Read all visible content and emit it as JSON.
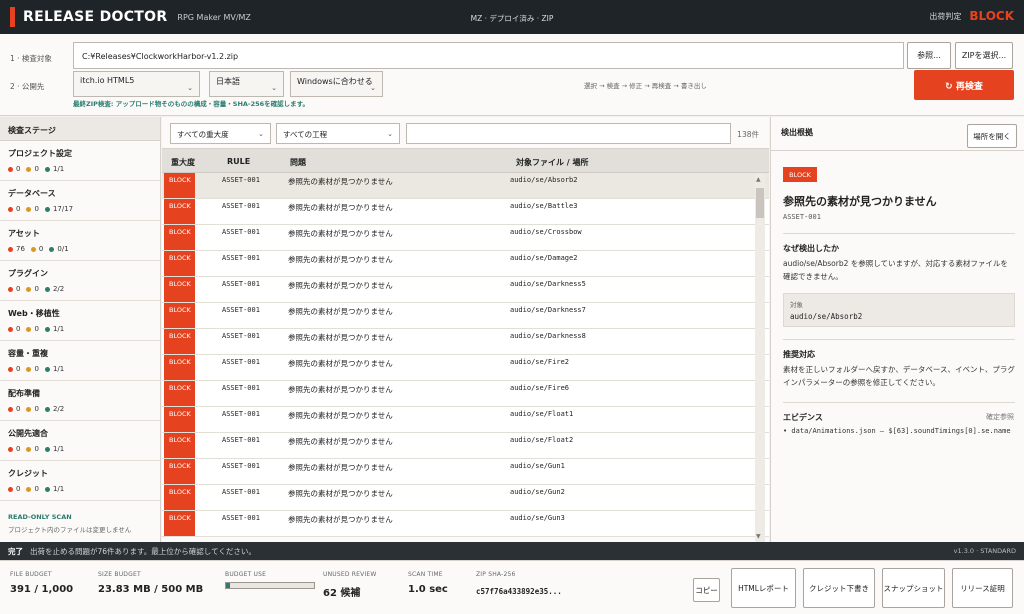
{
  "app": {
    "title": "RELEASE DOCTOR",
    "subtitle": "RPG Maker MV/MZ",
    "center_status": "MZ · デプロイ済み · ZIP",
    "verdict_label": "出荷判定",
    "verdict_value": "BLOCK"
  },
  "inputs": {
    "target_label": "1 · 検査対象",
    "target_path": "C:¥Releases¥ClockworkHarbor-v1.2.zip",
    "browse_label": "参照...",
    "zip_select_label": "ZIPを選択...",
    "publish_label": "2 · 公開先",
    "platform": "itch.io HTML5",
    "language": "日本語",
    "environment": "Windowsに合わせる",
    "flow": "選択 → 検査 → 修正 → 再検査 → 書き出し",
    "rescan_label": "↻ 再検査",
    "zip_note": "最終ZIP検査: アップロード物そのものの構成・容量・SHA-256を確認します。"
  },
  "stages": {
    "header": "検査ステージ",
    "items": [
      {
        "name": "プロジェクト設定",
        "red": "0",
        "amber": "0",
        "teal": "1/1"
      },
      {
        "name": "データベース",
        "red": "0",
        "amber": "0",
        "teal": "17/17"
      },
      {
        "name": "アセット",
        "red": "76",
        "amber": "0",
        "teal": "0/1"
      },
      {
        "name": "プラグイン",
        "red": "0",
        "amber": "0",
        "teal": "2/2"
      },
      {
        "name": "Web・移植性",
        "red": "0",
        "amber": "0",
        "teal": "1/1"
      },
      {
        "name": "容量・重複",
        "red": "0",
        "amber": "0",
        "teal": "1/1"
      },
      {
        "name": "配布準備",
        "red": "0",
        "amber": "0",
        "teal": "2/2"
      },
      {
        "name": "公開先適合",
        "red": "0",
        "amber": "0",
        "teal": "1/1"
      },
      {
        "name": "クレジット",
        "red": "0",
        "amber": "0",
        "teal": "1/1"
      }
    ],
    "readonly_title": "READ-ONLY SCAN",
    "readonly_desc": "プロジェクト内のファイルは変更しません"
  },
  "filters": {
    "severity": "すべての重大度",
    "process": "すべての工程",
    "search_value": "",
    "count": "138件"
  },
  "table": {
    "headers": {
      "severity": "重大度",
      "rule": "RULE",
      "issue": "問題",
      "file": "対象ファイル / 場所"
    },
    "rows": [
      {
        "severity": "BLOCK",
        "rule": "ASSET-001",
        "issue": "参照先の素材が見つかりません",
        "file": "audio/se/Absorb2"
      },
      {
        "severity": "BLOCK",
        "rule": "ASSET-001",
        "issue": "参照先の素材が見つかりません",
        "file": "audio/se/Battle3"
      },
      {
        "severity": "BLOCK",
        "rule": "ASSET-001",
        "issue": "参照先の素材が見つかりません",
        "file": "audio/se/Crossbow"
      },
      {
        "severity": "BLOCK",
        "rule": "ASSET-001",
        "issue": "参照先の素材が見つかりません",
        "file": "audio/se/Damage2"
      },
      {
        "severity": "BLOCK",
        "rule": "ASSET-001",
        "issue": "参照先の素材が見つかりません",
        "file": "audio/se/Darkness5"
      },
      {
        "severity": "BLOCK",
        "rule": "ASSET-001",
        "issue": "参照先の素材が見つかりません",
        "file": "audio/se/Darkness7"
      },
      {
        "severity": "BLOCK",
        "rule": "ASSET-001",
        "issue": "参照先の素材が見つかりません",
        "file": "audio/se/Darkness8"
      },
      {
        "severity": "BLOCK",
        "rule": "ASSET-001",
        "issue": "参照先の素材が見つかりません",
        "file": "audio/se/Fire2"
      },
      {
        "severity": "BLOCK",
        "rule": "ASSET-001",
        "issue": "参照先の素材が見つかりません",
        "file": "audio/se/Fire6"
      },
      {
        "severity": "BLOCK",
        "rule": "ASSET-001",
        "issue": "参照先の素材が見つかりません",
        "file": "audio/se/Float1"
      },
      {
        "severity": "BLOCK",
        "rule": "ASSET-001",
        "issue": "参照先の素材が見つかりません",
        "file": "audio/se/Float2"
      },
      {
        "severity": "BLOCK",
        "rule": "ASSET-001",
        "issue": "参照先の素材が見つかりません",
        "file": "audio/se/Gun1"
      },
      {
        "severity": "BLOCK",
        "rule": "ASSET-001",
        "issue": "参照先の素材が見つかりません",
        "file": "audio/se/Gun2"
      },
      {
        "severity": "BLOCK",
        "rule": "ASSET-001",
        "issue": "参照先の素材が見つかりません",
        "file": "audio/se/Gun3"
      }
    ]
  },
  "detail": {
    "header": "検出根拠",
    "locate_label": "場所を開く",
    "badge": "BLOCK",
    "title": "参照先の素材が見つかりません",
    "rule": "ASSET-001",
    "why_title": "なぜ検出したか",
    "why_text": "audio/se/Absorb2 を参照していますが、対応する素材ファイルを確認できません。",
    "target_label": "対象",
    "target_value": "audio/se/Absorb2",
    "fix_title": "推奨対応",
    "fix_text": "素材を正しいフォルダーへ戻すか、データベース、イベント、プラグインパラメーターの参照を修正してください。",
    "evidence_title": "エビデンス",
    "evidence_link": "確定参照",
    "evidence_item": "• data/Animations.json — $[63].soundTimings[0].se.name"
  },
  "status": {
    "label": "完了",
    "message": "出荷を止める問題が76件あります。最上位から確認してください。",
    "version": "v1.3.0 · STANDARD"
  },
  "footer": {
    "file_budget_label": "FILE BUDGET",
    "file_budget_value": "391 / 1,000",
    "size_budget_label": "SIZE BUDGET",
    "size_budget_value": "23.83 MB / 500 MB",
    "budget_use_label": "BUDGET USE",
    "budget_use_fraction": 0.05,
    "unused_label": "UNUSED REVIEW",
    "unused_value": "62 候補",
    "scan_time_label": "SCAN TIME",
    "scan_time_value": "1.0 sec",
    "sha_label": "ZIP SHA-256",
    "sha_value": "c57f76a433892e35...",
    "copy_label": "コピー",
    "html_report_label": "HTMLレポート",
    "credit_draft_label": "クレジット下書き",
    "snapshot_label": "スナップショット",
    "release_cert_label": "リリース証明"
  },
  "colors": {
    "accent": "#e5431f",
    "dark": "#1f2428",
    "teal": "#2b7d6f",
    "amber": "#d99a1e",
    "red": "#e5431f"
  }
}
